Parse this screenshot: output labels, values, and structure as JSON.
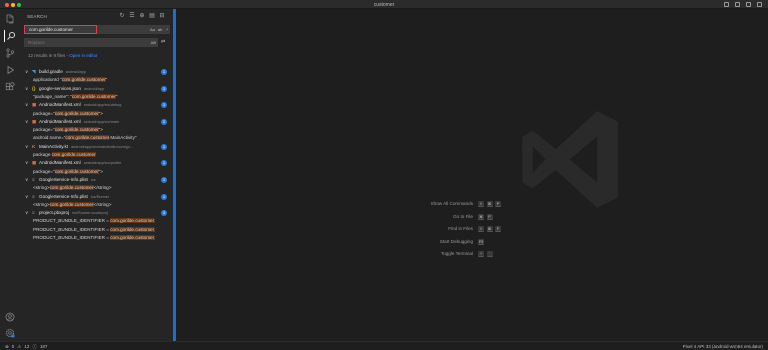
{
  "window": {
    "title": "customer"
  },
  "sidebar": {
    "title": "SEARCH",
    "search": {
      "value": "com.gorilde.customer",
      "options": [
        "Aa",
        "ab",
        ".*"
      ]
    },
    "replace": {
      "placeholder": "Replace",
      "option": "AB"
    },
    "summary": {
      "text": "12 results in 9 files - ",
      "link": "Open in editor"
    },
    "results": [
      {
        "icon": "gradle-icon",
        "glyph": "◥",
        "color": "#3e9bd6",
        "name": "build.gradle",
        "path": "android/app",
        "count": "1",
        "matches": [
          {
            "pre": "applicationId \"",
            "hit": "com.gorilde.customer",
            "post": "\""
          }
        ]
      },
      {
        "icon": "json-icon",
        "glyph": "{}",
        "color": "#d7ba3b",
        "name": "google-services.json",
        "path": "android/app",
        "count": "1",
        "matches": [
          {
            "pre": "\"package_name\": \"",
            "hit": "com.gorilde.customer",
            "post": "\""
          }
        ]
      },
      {
        "icon": "xml-icon",
        "glyph": "▣",
        "color": "#e06c3b",
        "name": "AndroidManifest.xml",
        "path": "android/app/src/debug",
        "count": "1",
        "matches": [
          {
            "pre": "package=\"",
            "hit": "com.gorilde.customer",
            "post": "\">"
          }
        ]
      },
      {
        "icon": "xml-icon",
        "glyph": "▣",
        "color": "#e06c3b",
        "name": "AndroidManifest.xml",
        "path": "android/app/src/main",
        "count": "2",
        "matches": [
          {
            "pre": "package=\"",
            "hit": "com.gorilde.customer",
            "post": "\">"
          },
          {
            "pre": "android:name=\"",
            "hit": "com.gorilde.customer",
            "post": ".MainActivity\""
          }
        ]
      },
      {
        "icon": "kotlin-icon",
        "glyph": "K",
        "color": "#e06c3b",
        "name": "MainActivity.kt",
        "path": "android/app/src/main/kotlin/com/go...",
        "count": "1",
        "matches": [
          {
            "pre": "package ",
            "hit": "com.gorilde.customer",
            "post": ""
          }
        ]
      },
      {
        "icon": "xml-icon",
        "glyph": "▣",
        "color": "#e06c3b",
        "name": "AndroidManifest.xml",
        "path": "android/app/src/profile",
        "count": "1",
        "matches": [
          {
            "pre": "package=\"",
            "hit": "com.gorilde.customer",
            "post": "\">"
          }
        ]
      },
      {
        "icon": "plist-icon",
        "glyph": "≡",
        "color": "#b0b0b0",
        "name": "GoogleService-Info.plist",
        "path": "ios",
        "count": "1",
        "matches": [
          {
            "pre": "<string>",
            "hit": "com.gorilde.customer",
            "post": "</string>"
          }
        ]
      },
      {
        "icon": "plist-icon",
        "glyph": "≡",
        "color": "#b0b0b0",
        "name": "GoogleService-Info.plist",
        "path": "ios/Runner",
        "count": "1",
        "matches": [
          {
            "pre": "<string>",
            "hit": "com.gorilde.customer",
            "post": "</string>"
          }
        ]
      },
      {
        "icon": "pbxproj-icon",
        "glyph": "≡",
        "color": "#b0b0b0",
        "name": "project.pbxproj",
        "path": "ios/Runner.xcodeproj",
        "count": "3",
        "matches": [
          {
            "pre": "PRODUCT_BUNDLE_IDENTIFIER = ",
            "hit": "com.gorilde.customer",
            "post": ";"
          },
          {
            "pre": "PRODUCT_BUNDLE_IDENTIFIER = ",
            "hit": "com.gorilde.customer",
            "post": ";"
          },
          {
            "pre": "PRODUCT_BUNDLE_IDENTIFIER = ",
            "hit": "com.gorilde.customer",
            "post": ";"
          }
        ]
      }
    ]
  },
  "editor": {
    "shortcuts": [
      {
        "label": "Show All Commands",
        "keys": [
          "⇧",
          "⌘",
          "P"
        ]
      },
      {
        "label": "Go to File",
        "keys": [
          "⌘",
          "P"
        ]
      },
      {
        "label": "Find in Files",
        "keys": [
          "⇧",
          "⌘",
          "F"
        ]
      },
      {
        "label": "Start Debugging",
        "keys": [
          "F5"
        ]
      },
      {
        "label": "Toggle Terminal",
        "keys": [
          "^",
          "`"
        ]
      }
    ]
  },
  "status": {
    "errors": "0",
    "warnings": "12",
    "info": "187",
    "device": "Pixel 4 API 33 (android-arm64 emulator)"
  },
  "colors": {
    "accent": "#2f7bd9",
    "highlight": "#613214",
    "focus_border": "#e0413f"
  }
}
